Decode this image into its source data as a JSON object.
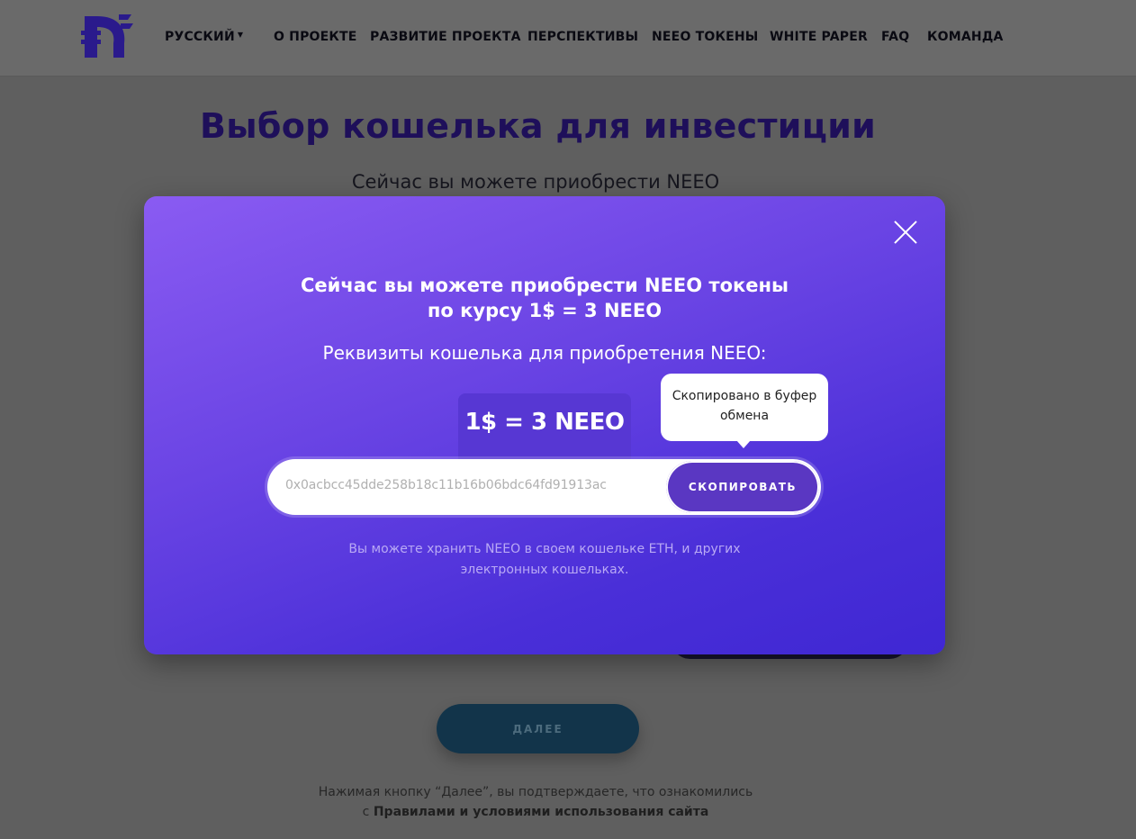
{
  "header": {
    "nav": [
      {
        "label": "РУССКИЙ",
        "dropdown": true
      },
      {
        "label": "О ПРОЕКТЕ"
      },
      {
        "label": "РАЗВИТИЕ ПРОЕКТА"
      },
      {
        "label": "ПЕРСПЕКТИВЫ"
      },
      {
        "label": "NEEO ТОКЕНЫ"
      },
      {
        "label": "WHITE PAPER"
      },
      {
        "label": "FAQ"
      },
      {
        "label": "КОМАНДА"
      }
    ]
  },
  "page": {
    "title": "Выбор кошелька для инвестиции",
    "subtitle": "Сейчас вы можете приобрести NEEO",
    "next_label": "ДАЛЕЕ",
    "agree_text": "Нажимая кнопку “Далее”, вы подтверждаете, что ознакомились",
    "agree_prefix": "с",
    "agree_link": "Правилами и условиями использования сайта"
  },
  "modal": {
    "title": "Сейчас вы можете приобрести NEEO токены по курсу 1$ = 3 NEEO",
    "subtitle": "Реквизиты кошелька для приобретения NEEO:",
    "rate": "1$ = 3 NEEO",
    "tooltip": "Скопировано в буфер обмена",
    "address": "0x0acbcc45dde258b18c11b16b06bdc64fd91913ac",
    "copy_label": "СКОПИРОВАТЬ",
    "note": "Вы можете хранить NEEO в своем кошельке ETH, и других электронных кошельках."
  },
  "colors": {
    "brand": "#2a1a8c",
    "modal_start": "#8a5bf2",
    "modal_end": "#3f27d3",
    "title_text": "#1e0f5a"
  },
  "icons": {
    "close": "close-icon",
    "logo": "neeo-logo"
  }
}
